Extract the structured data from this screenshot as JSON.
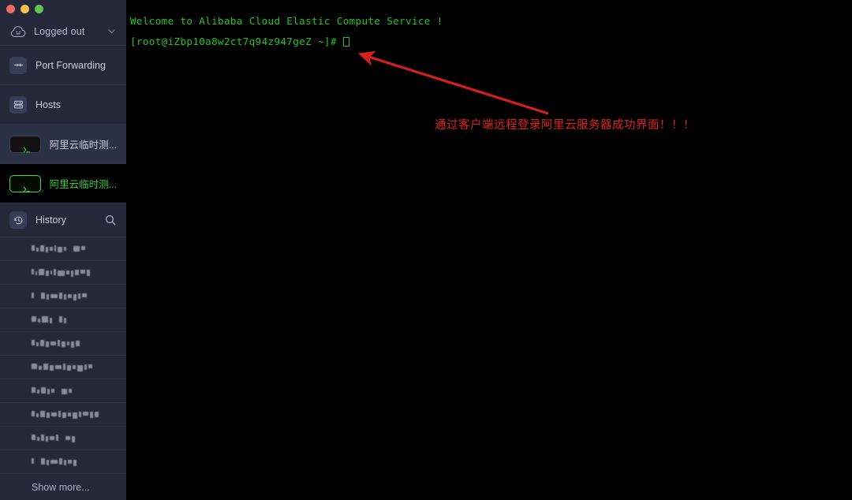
{
  "window": {
    "traffic_lights": [
      {
        "name": "close-button",
        "color": "#ec6a5f"
      },
      {
        "name": "minimize-button",
        "color": "#f4bf50"
      },
      {
        "name": "maximize-button",
        "color": "#61c454"
      }
    ]
  },
  "sidebar": {
    "account": {
      "label": "Logged out",
      "avatar_icon": "cloud-avatar-icon",
      "chevron_icon": "chevron-down-icon"
    },
    "nav": [
      {
        "label": "Port Forwarding",
        "icon": "port-forwarding-icon",
        "state": "normal"
      },
      {
        "label": "Hosts",
        "icon": "hosts-server-icon",
        "state": "normal"
      },
      {
        "label": "阿里云临时测...",
        "icon": "terminal-prompt-icon",
        "state": "selected"
      },
      {
        "label": "阿里云临时测...",
        "icon": "terminal-prompt-icon",
        "state": "active"
      }
    ],
    "history": {
      "label": "History",
      "icon": "clock-rewind-icon",
      "search_icon": "search-icon",
      "items": [
        {
          "label": "",
          "redacted": true
        },
        {
          "label": "",
          "redacted": true
        },
        {
          "label": "",
          "redacted": true
        },
        {
          "label": "",
          "redacted": true
        },
        {
          "label": "",
          "redacted": true
        },
        {
          "label": "",
          "redacted": true
        },
        {
          "label": "",
          "redacted": true
        },
        {
          "label": "",
          "redacted": true
        },
        {
          "label": "",
          "redacted": true
        },
        {
          "label": "",
          "redacted": true
        }
      ],
      "show_more_label": "Show more..."
    }
  },
  "terminal": {
    "welcome_line": "Welcome to Alibaba Cloud Elastic Compute Service !",
    "prompt_line": "[root@iZbp10a8w2ct7q94z947geZ ~]# ",
    "text_color": "#22c422",
    "background": "#000000"
  },
  "annotation": {
    "text": "通过客户端远程登录阿里云服务器成功界面！！！",
    "color": "#e02020",
    "arrow_icon": "red-arrow-icon"
  }
}
